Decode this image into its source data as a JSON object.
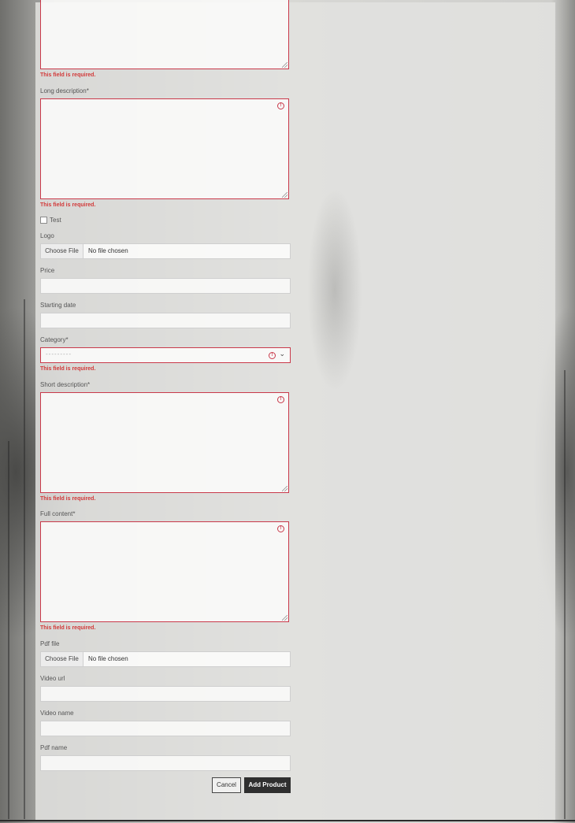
{
  "form": {
    "errors": {
      "required": "This field is required."
    },
    "long_description": {
      "label": "Long description*",
      "value": ""
    },
    "test_checkbox": {
      "label": "Test",
      "checked": false
    },
    "logo": {
      "label": "Logo",
      "button": "Choose File",
      "status": "No file chosen"
    },
    "price": {
      "label": "Price",
      "value": ""
    },
    "starting_date": {
      "label": "Starting date",
      "value": ""
    },
    "category": {
      "label": "Category*",
      "selected": "---------"
    },
    "short_description": {
      "label": "Short description*",
      "value": ""
    },
    "full_content": {
      "label": "Full content*",
      "value": ""
    },
    "pdf_file": {
      "label": "Pdf file",
      "button": "Choose File",
      "status": "No file chosen"
    },
    "video_url": {
      "label": "Video url",
      "value": ""
    },
    "video_name": {
      "label": "Video name",
      "value": ""
    },
    "pdf_name": {
      "label": "Pdf name",
      "value": ""
    },
    "actions": {
      "cancel": "Cancel",
      "submit": "Add Product"
    }
  },
  "icons": {
    "field_alert": "alert-circle-icon",
    "select_chevron": "chevron-down-icon",
    "resize": "resize-grip-icon"
  },
  "colors": {
    "error": "#d23a3a",
    "primary_button": "#2f2f2f"
  }
}
